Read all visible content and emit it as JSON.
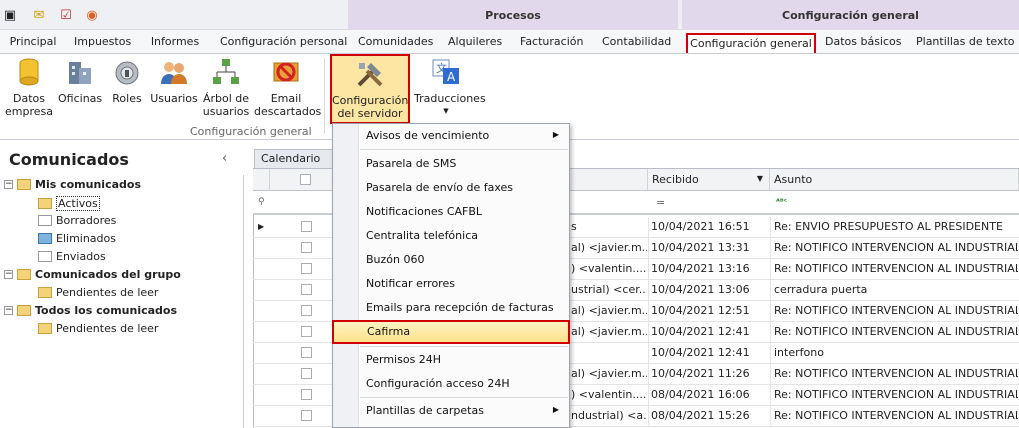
{
  "quick_access": [
    "app-icon",
    "mail-icon",
    "task-icon",
    "rss-icon"
  ],
  "context_groups": {
    "procesos": "Procesos",
    "config_general": "Configuración general"
  },
  "tabs": [
    "Principal",
    "Impuestos",
    "Informes",
    "Configuración personal",
    "Comunidades",
    "Alquileres",
    "Facturación",
    "Contabilidad",
    "Configuración general",
    "Datos básicos",
    "Plantillas de texto"
  ],
  "ribbon": {
    "buttons": [
      "Datos empresa",
      "Oficinas",
      "Roles",
      "Usuarios",
      "Árbol de usuarios",
      "Email descartados",
      "Configuración del servidor",
      "Traducciones"
    ],
    "group_label": "Configuración general"
  },
  "left": {
    "title": "Comunicados",
    "collapse": "‹",
    "tree": [
      "Mis comunicados",
      "Activos",
      "Borradores",
      "Eliminados",
      "Enviados",
      "Comunicados del grupo",
      "Pendientes de leer",
      "Todos los comunicados",
      "Pendientes de leer"
    ]
  },
  "grid": {
    "tab": "Calendario",
    "col_recibido": "Recibido",
    "col_asunto": "Asunto",
    "filter_eq": "=",
    "rows": [
      {
        "from": "s",
        "date": "10/04/2021 16:51",
        "subject": "Re: ENVIO PRESUPUESTO AL PRESIDENTE"
      },
      {
        "from": "al) <javier.m...",
        "date": "10/04/2021 13:31",
        "subject": "Re: NOTIFICO INTERVENCION AL INDUSTRIAL"
      },
      {
        "from": ") <valentin....",
        "date": "10/04/2021 13:16",
        "subject": "Re: NOTIFICO INTERVENCION AL INDUSTRIAL"
      },
      {
        "from": "ustrial) <cer...",
        "date": "10/04/2021 13:06",
        "subject": "cerradura puerta"
      },
      {
        "from": "al) <javier.m...",
        "date": "10/04/2021 12:51",
        "subject": "Re: NOTIFICO INTERVENCION AL INDUSTRIAL"
      },
      {
        "from": "al) <javier.m...",
        "date": "10/04/2021 12:41",
        "subject": "Re: NOTIFICO INTERVENCION AL INDUSTRIAL"
      },
      {
        "from": "",
        "date": "10/04/2021 12:41",
        "subject": "interfono"
      },
      {
        "from": "al) <javier.m...",
        "date": "10/04/2021 11:26",
        "subject": "Re: NOTIFICO INTERVENCION AL INDUSTRIAL"
      },
      {
        "from": ") <valentin....",
        "date": "08/04/2021 16:06",
        "subject": "Re: NOTIFICO INTERVENCION AL INDUSTRIAL"
      },
      {
        "from": "ndustrial) <a...",
        "date": "08/04/2021 15:26",
        "subject": "Re: NOTIFICO INTERVENCION AL INDUSTRIAL"
      }
    ]
  },
  "menu": [
    "Avisos de vencimiento",
    "Pasarela de SMS",
    "Pasarela de envío de faxes",
    "Notificaciones CAFBL",
    "Centralita telefónica",
    "Buzón 060",
    "Notificar errores",
    "Emails para recepción de facturas",
    "Cafirma",
    "Permisos 24H",
    "Configuración acceso 24H",
    "Plantillas de carpetas"
  ],
  "colors": {
    "highlight_border": "#d00000",
    "highlight_fill": "#fde28a",
    "context_tab": "#e1d8ec"
  }
}
